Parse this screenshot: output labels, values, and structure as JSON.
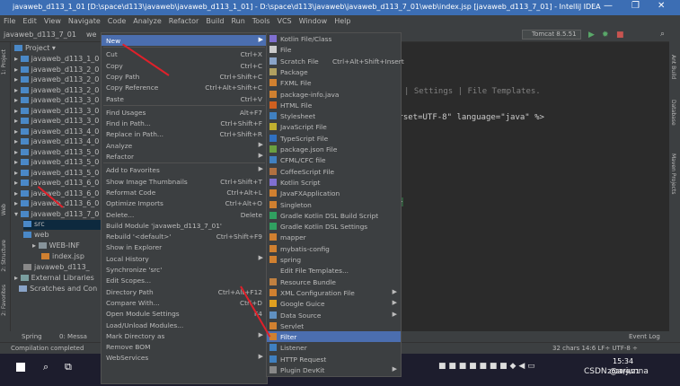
{
  "window": {
    "title": "javaweb_d113_1_01 [D:\\space\\d113\\javaweb\\javaweb_d113_1_01] - D:\\space\\d113\\javaweb\\javaweb_d113_7_01\\web\\index.jsp [javaweb_d113_7_01] - IntelliJ IDEA",
    "minimize": "—",
    "maximize": "❐",
    "close": "✕"
  },
  "menubar": [
    "File",
    "Edit",
    "View",
    "Navigate",
    "Code",
    "Analyze",
    "Refactor",
    "Build",
    "Run",
    "Tools",
    "VCS",
    "Window",
    "Help"
  ],
  "navbar": {
    "project": "javaweb_d113_7_01",
    "module": "we",
    "run_config": "Tomcat 8.5.51"
  },
  "sidebar": {
    "tab": "Project",
    "left_tabs": [
      "1: Project",
      "2: Structure",
      "Web",
      "2: Favorites"
    ],
    "right_tabs": [
      "Ant Build",
      "Database",
      "Maven Projects"
    ]
  },
  "tree": {
    "header": "Project",
    "rows": [
      "javaweb_d113_1_0",
      "javaweb_d113_2_0",
      "javaweb_d113_2_0",
      "javaweb_d113_2_0",
      "javaweb_d113_3_0",
      "javaweb_d113_3_0",
      "javaweb_d113_3_0",
      "javaweb_d113_4_0",
      "javaweb_d113_4_0",
      "javaweb_d113_5_0",
      "javaweb_d113_5_0",
      "javaweb_d113_5_0",
      "javaweb_d113_6_0",
      "javaweb_d113_6_0",
      "javaweb_d113_6_0",
      "javaweb_d113_7_0"
    ],
    "src": "src",
    "web": "web",
    "webinf": "WEB-INF",
    "indexjsp": "index.jsp",
    "iml": "javaweb_d113_",
    "ext": "External Libraries",
    "scratch": "Scratches and Con"
  },
  "editor": {
    "line1": "| Settings | File Templates.",
    "line2": "arset=UTF-8\" language=\"java\" %>",
    "line3": "l}"
  },
  "context_menu": [
    {
      "label": "New",
      "shortcut": "",
      "submenu": true,
      "selected": true
    },
    {
      "sep": true
    },
    {
      "label": "Cut",
      "shortcut": "Ctrl+X"
    },
    {
      "label": "Copy",
      "shortcut": "Ctrl+C"
    },
    {
      "label": "Copy Path",
      "shortcut": "Ctrl+Shift+C"
    },
    {
      "label": "Copy Reference",
      "shortcut": "Ctrl+Alt+Shift+C"
    },
    {
      "label": "Paste",
      "shortcut": "Ctrl+V"
    },
    {
      "sep": true
    },
    {
      "label": "Find Usages",
      "shortcut": "Alt+F7"
    },
    {
      "label": "Find in Path...",
      "shortcut": "Ctrl+Shift+F"
    },
    {
      "label": "Replace in Path...",
      "shortcut": "Ctrl+Shift+R"
    },
    {
      "label": "Analyze",
      "shortcut": "",
      "submenu": true
    },
    {
      "label": "Refactor",
      "shortcut": "",
      "submenu": true
    },
    {
      "sep": true
    },
    {
      "label": "Add to Favorites",
      "shortcut": "",
      "submenu": true
    },
    {
      "label": "Show Image Thumbnails",
      "shortcut": "Ctrl+Shift+T"
    },
    {
      "label": "Reformat Code",
      "shortcut": "Ctrl+Alt+L"
    },
    {
      "label": "Optimize Imports",
      "shortcut": "Ctrl+Alt+O"
    },
    {
      "label": "Delete...",
      "shortcut": "Delete"
    },
    {
      "label": "Build Module 'javaweb_d113_7_01'",
      "shortcut": ""
    },
    {
      "label": "Rebuild '<default>'",
      "shortcut": "Ctrl+Shift+F9"
    },
    {
      "label": "Show in Explorer",
      "shortcut": ""
    },
    {
      "label": "Local History",
      "shortcut": "",
      "submenu": true
    },
    {
      "label": "Synchronize 'src'",
      "shortcut": ""
    },
    {
      "label": "Edit Scopes...",
      "shortcut": ""
    },
    {
      "label": "Directory Path",
      "shortcut": "Ctrl+Alt+F12"
    },
    {
      "label": "Compare With...",
      "shortcut": "Ctrl+D"
    },
    {
      "label": "Open Module Settings",
      "shortcut": "F4"
    },
    {
      "label": "Load/Unload Modules...",
      "shortcut": ""
    },
    {
      "label": "Mark Directory as",
      "shortcut": "",
      "submenu": true
    },
    {
      "label": "Remove BOM",
      "shortcut": ""
    },
    {
      "label": "WebServices",
      "shortcut": "",
      "submenu": true
    }
  ],
  "submenu": [
    {
      "label": "Kotlin File/Class",
      "icon": "#7f6fd0"
    },
    {
      "label": "File",
      "icon": "#cccccc"
    },
    {
      "label": "Scratch File",
      "shortcut": "Ctrl+Alt+Shift+Insert",
      "icon": "#8aa4c8"
    },
    {
      "label": "Package",
      "icon": "#b0a060"
    },
    {
      "label": "FXML File",
      "icon": "#d08030"
    },
    {
      "label": "package-info.java",
      "icon": "#d08030"
    },
    {
      "label": "HTML File",
      "icon": "#d06020"
    },
    {
      "label": "Stylesheet",
      "icon": "#4080c0"
    },
    {
      "label": "JavaScript File",
      "icon": "#c0b030"
    },
    {
      "label": "TypeScript File",
      "icon": "#3070c0"
    },
    {
      "label": "package.json File",
      "icon": "#6aa040"
    },
    {
      "label": "CFML/CFC file",
      "icon": "#4080c0"
    },
    {
      "label": "CoffeeScript File",
      "icon": "#b07040"
    },
    {
      "label": "Kotlin Script",
      "icon": "#7f6fd0"
    },
    {
      "label": "JavaFXApplication",
      "icon": "#d08030"
    },
    {
      "label": "Singleton",
      "icon": "#d08030"
    },
    {
      "label": "Gradle Kotlin DSL Build Script",
      "icon": "#30a060"
    },
    {
      "label": "Gradle Kotlin DSL Settings",
      "icon": "#30a060"
    },
    {
      "label": "mapper",
      "icon": "#d08030"
    },
    {
      "label": "mybatis-config",
      "icon": "#d08030"
    },
    {
      "label": "spring",
      "icon": "#d08030"
    },
    {
      "label": "Edit File Templates...",
      "icon": ""
    },
    {
      "label": "Resource Bundle",
      "icon": "#c08040"
    },
    {
      "label": "XML Configuration File",
      "icon": "#d08030",
      "submenu": true
    },
    {
      "label": "Google Guice",
      "icon": "#e0a020",
      "submenu": true
    },
    {
      "label": "Data Source",
      "icon": "#6090c0",
      "submenu": true
    },
    {
      "label": "Servlet",
      "icon": "#d08030"
    },
    {
      "label": "Filter",
      "icon": "#d08030",
      "selected": true
    },
    {
      "label": "Listener",
      "icon": "#4080c0"
    },
    {
      "label": "HTTP Request",
      "icon": "#4080c0"
    },
    {
      "label": "Plugin DevKit",
      "icon": "#888888",
      "submenu": true
    }
  ],
  "bottom": {
    "spring": "Spring",
    "messages": "0: Messa",
    "compile": "Compilation completed",
    "event_log": "Event Log",
    "status": "32 chars  14:6  LF÷  UTF-8 ÷"
  },
  "taskbar": {
    "time": "15:34",
    "date": "2020/4/21",
    "watermark": "CSDN @arjunna"
  }
}
